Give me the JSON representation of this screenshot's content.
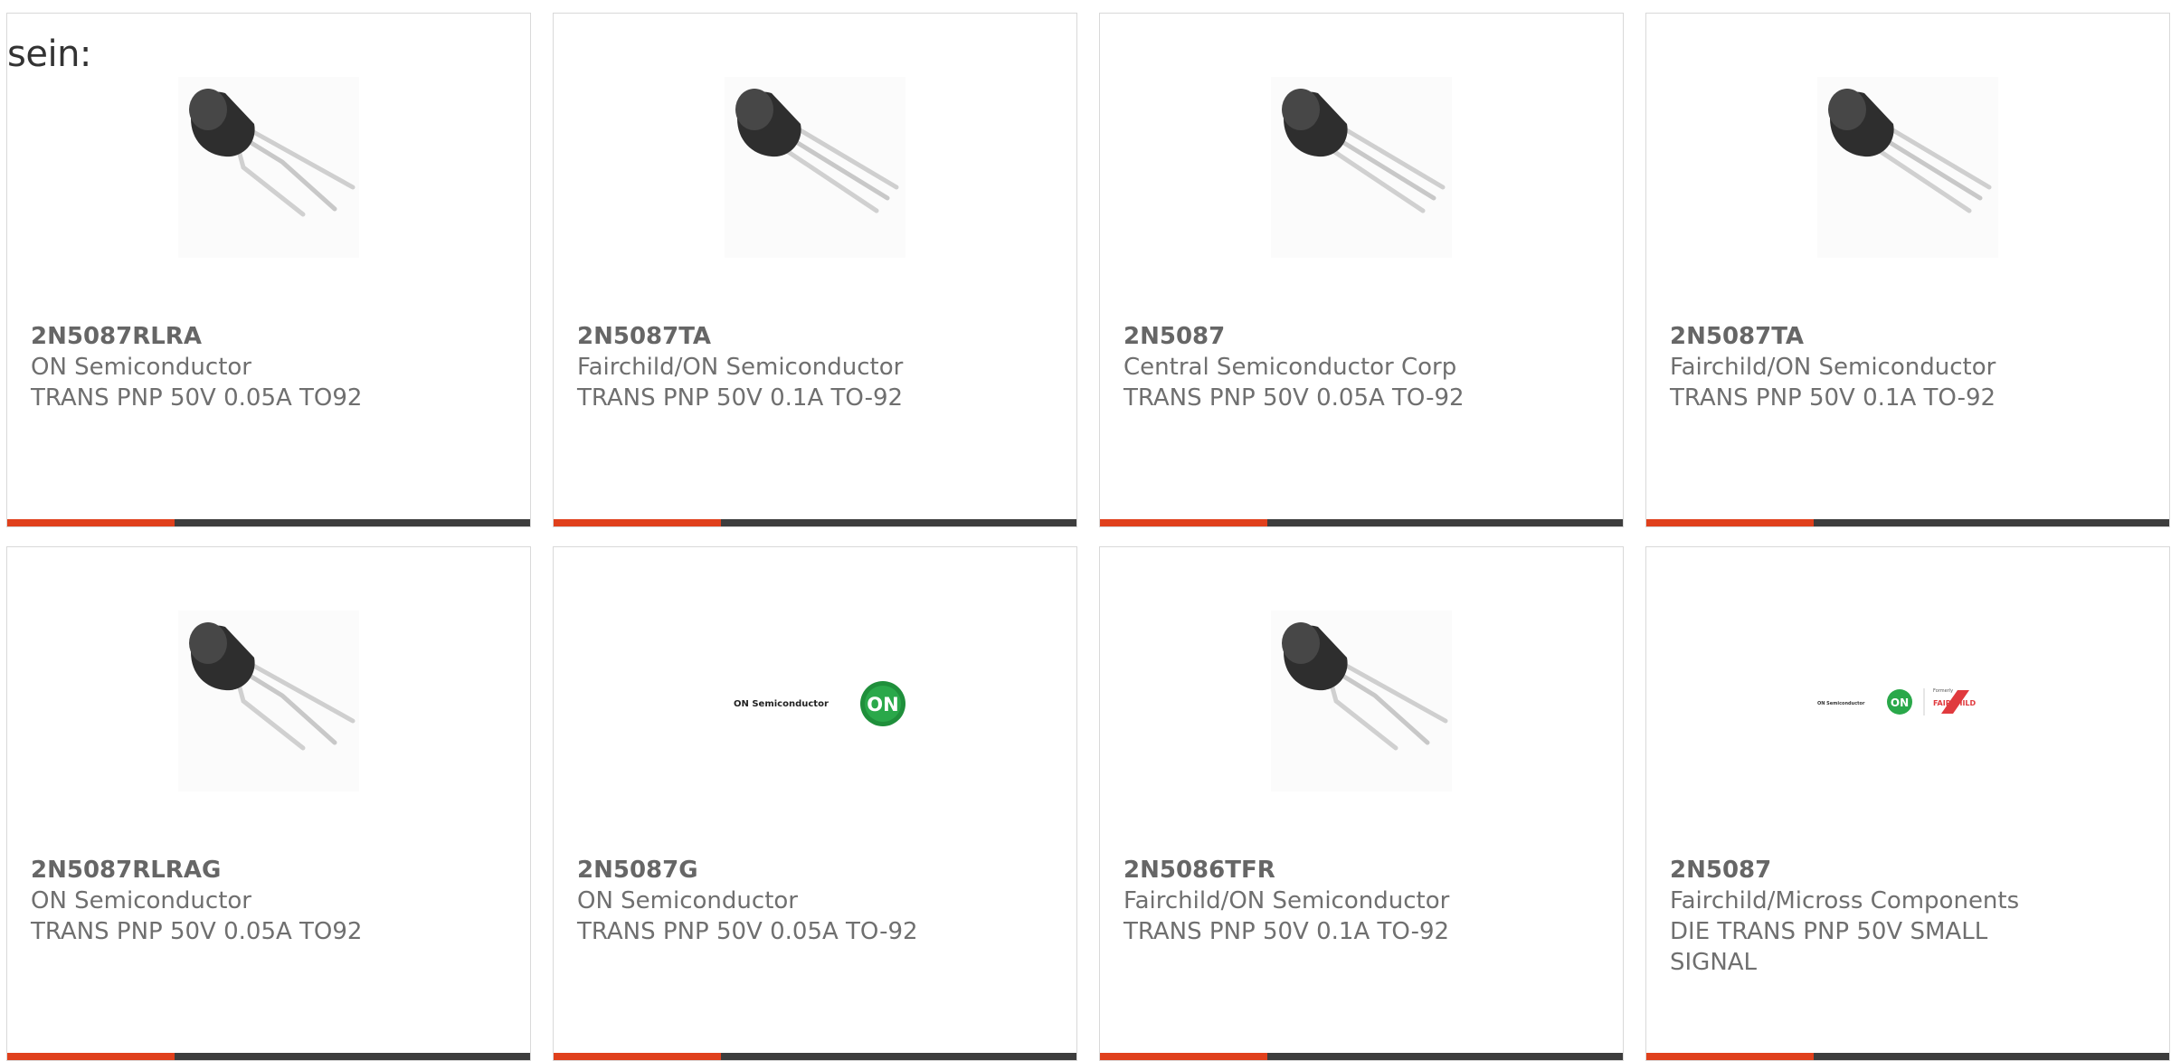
{
  "heading": "sein:",
  "accent_color": "#e0401c",
  "bar_color": "#3d3d3d",
  "products": [
    {
      "part_number": "2N5087RLRA",
      "manufacturer": "ON Semiconductor",
      "description": "TRANS PNP 50V 0.05A TO92",
      "image": "transistor-to92-bent-leads",
      "progress": 0.32
    },
    {
      "part_number": "2N5087TA",
      "manufacturer": "Fairchild/ON Semiconductor",
      "description": "TRANS PNP 50V 0.1A TO-92",
      "image": "transistor-to92-straight-leads",
      "progress": 0.32
    },
    {
      "part_number": "2N5087",
      "manufacturer": "Central Semiconductor Corp",
      "description": "TRANS PNP 50V 0.05A TO-92",
      "image": "transistor-to92-straight-leads",
      "progress": 0.32
    },
    {
      "part_number": "2N5087TA",
      "manufacturer": "Fairchild/ON Semiconductor",
      "description": "TRANS PNP 50V 0.1A TO-92",
      "image": "transistor-to92-straight-leads",
      "progress": 0.32
    },
    {
      "part_number": "2N5087RLRAG",
      "manufacturer": "ON Semiconductor",
      "description": "TRANS PNP 50V 0.05A TO92",
      "image": "transistor-to92-bent-leads",
      "progress": 0.32
    },
    {
      "part_number": "2N5087G",
      "manufacturer": "ON Semiconductor",
      "description": "TRANS PNP 50V 0.05A TO-92",
      "image": "on-semiconductor-logo",
      "logo_text": "ON Semiconductor",
      "logo_badge": "ON",
      "progress": 0.32
    },
    {
      "part_number": "2N5086TFR",
      "manufacturer": "Fairchild/ON Semiconductor",
      "description": "TRANS PNP 50V 0.1A TO-92",
      "image": "transistor-to92-bent-leads",
      "progress": 0.32
    },
    {
      "part_number": "2N5087",
      "manufacturer": "Fairchild/Micross Components",
      "description": "DIE TRANS PNP 50V SMALL SIGNAL",
      "image": "on-fairchild-logo",
      "logo_text": "ON Semiconductor",
      "logo_badge": "ON",
      "logo_small": "Formerly",
      "logo_brand": "FAIRCHILD",
      "progress": 0.32
    }
  ]
}
